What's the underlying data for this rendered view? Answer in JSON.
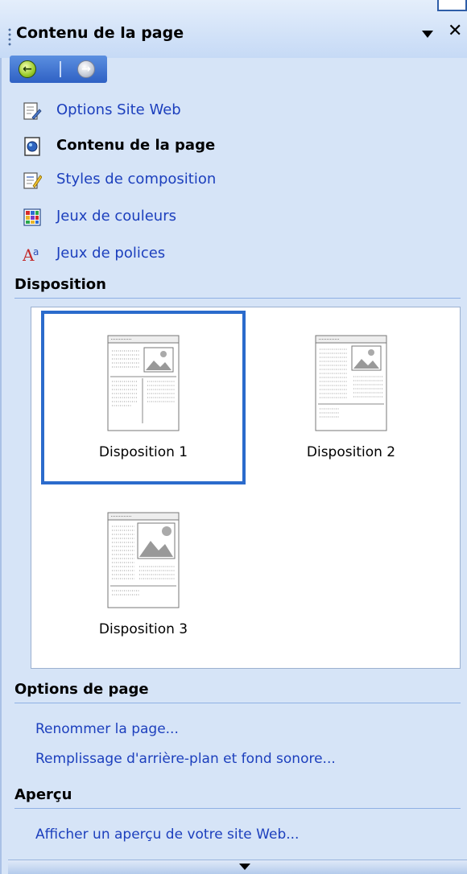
{
  "panel": {
    "title": "Contenu de la page",
    "close_glyph": "✕",
    "nav": {
      "back_icon": "back-arrow-icon",
      "forward_icon": "forward-arrow-icon"
    }
  },
  "links": [
    {
      "label": "Options Site Web",
      "icon": "site-options-icon",
      "current": false
    },
    {
      "label": "Contenu de la page",
      "icon": "page-content-icon",
      "current": true
    },
    {
      "label": "Styles de composition",
      "icon": "composition-styles-icon",
      "current": false
    },
    {
      "label": "Jeux de couleurs",
      "icon": "color-schemes-icon",
      "current": false
    },
    {
      "label": "Jeux de polices",
      "icon": "font-schemes-icon",
      "current": false
    }
  ],
  "layout_section": {
    "heading": "Disposition",
    "layouts": [
      {
        "label": "Disposition 1",
        "selected": true
      },
      {
        "label": "Disposition 2",
        "selected": false
      },
      {
        "label": "Disposition 3",
        "selected": false
      }
    ]
  },
  "page_options": {
    "heading": "Options de page",
    "rename": "Renommer la page...",
    "background": "Remplissage d'arrière-plan et fond sonore..."
  },
  "preview": {
    "heading": "Aperçu",
    "link": "Afficher un aperçu de votre site Web..."
  },
  "colors": {
    "link": "#1c3fbd",
    "selection": "#2b6bcc",
    "panel_bg": "#d6e4f7"
  }
}
